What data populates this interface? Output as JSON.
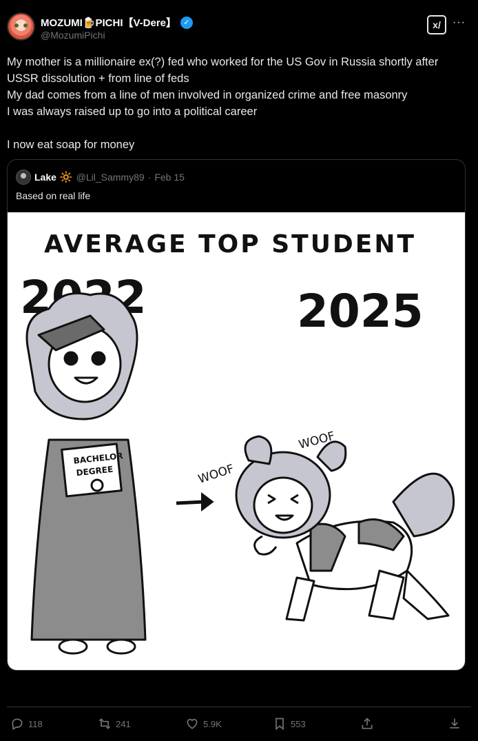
{
  "author": {
    "display_name": "MOZUMI🍺PICHI【V-Dere】",
    "handle": "@MozumiPichi",
    "verified": true,
    "avatar_icon": "anime-avatar"
  },
  "header_buttons": {
    "grok_label": "x/",
    "more_label": "···"
  },
  "tweet": {
    "lines": [
      "My mother is a millionaire ex(?) fed who worked for the US Gov in Russia shortly after",
      "USSR dissolution + from line of feds",
      "My dad comes from a line of men involved in organized crime and free masonry",
      "I was always raised up to go into a political career",
      "",
      "I now eat soap for money"
    ]
  },
  "quote": {
    "name": "Lake",
    "name_emoji": "🔆",
    "handle": "@Lil_Sammy89",
    "separator": "·",
    "date": "Feb 15",
    "text": "Based on real life",
    "image": {
      "title": "AVERAGE TOP STUDENT",
      "year_left": "2022",
      "year_right": "2025",
      "sign_line1": "BACHELOR",
      "sign_line2": "DEGREE",
      "woof1": "WOOF",
      "woof2": "WOOF"
    }
  },
  "actions": {
    "replies": "118",
    "reposts": "241",
    "likes": "5.9K",
    "bookmarks": "553"
  },
  "colors": {
    "background": "#000000",
    "text": "#e7e9ea",
    "muted": "#71767b",
    "verified": "#1d9bf0",
    "border": "#2f3336"
  }
}
